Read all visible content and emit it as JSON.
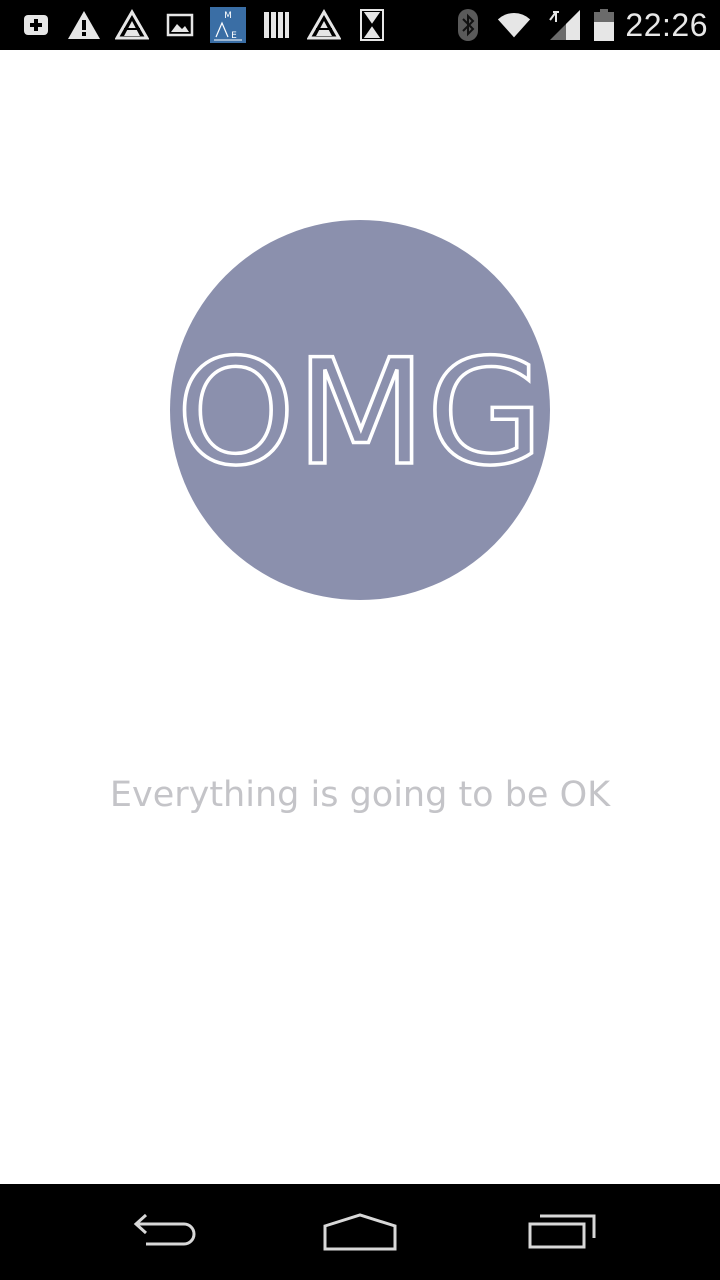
{
  "status_bar": {
    "time": "22:26",
    "notification_icons": [
      "add-icon",
      "warning-icon",
      "app-triangle-icon",
      "image-icon",
      "mae-app-icon",
      "library-icon",
      "app-triangle-icon",
      "hourglass-icon"
    ],
    "system_icons": [
      "bluetooth-icon",
      "wifi-icon",
      "signal-icon",
      "battery-icon"
    ]
  },
  "logo": {
    "text": "OMG",
    "circle_color": "#8b90ad"
  },
  "tagline": "Everything is going to be OK",
  "nav_bar": {
    "buttons": [
      "back-icon",
      "home-icon",
      "recent-apps-icon"
    ]
  },
  "colors": {
    "status_bar_bg": "#000000",
    "nav_bar_bg": "#000000",
    "tagline_color": "#c4c4c8",
    "app_icon_blue": "#3a6ea5"
  }
}
